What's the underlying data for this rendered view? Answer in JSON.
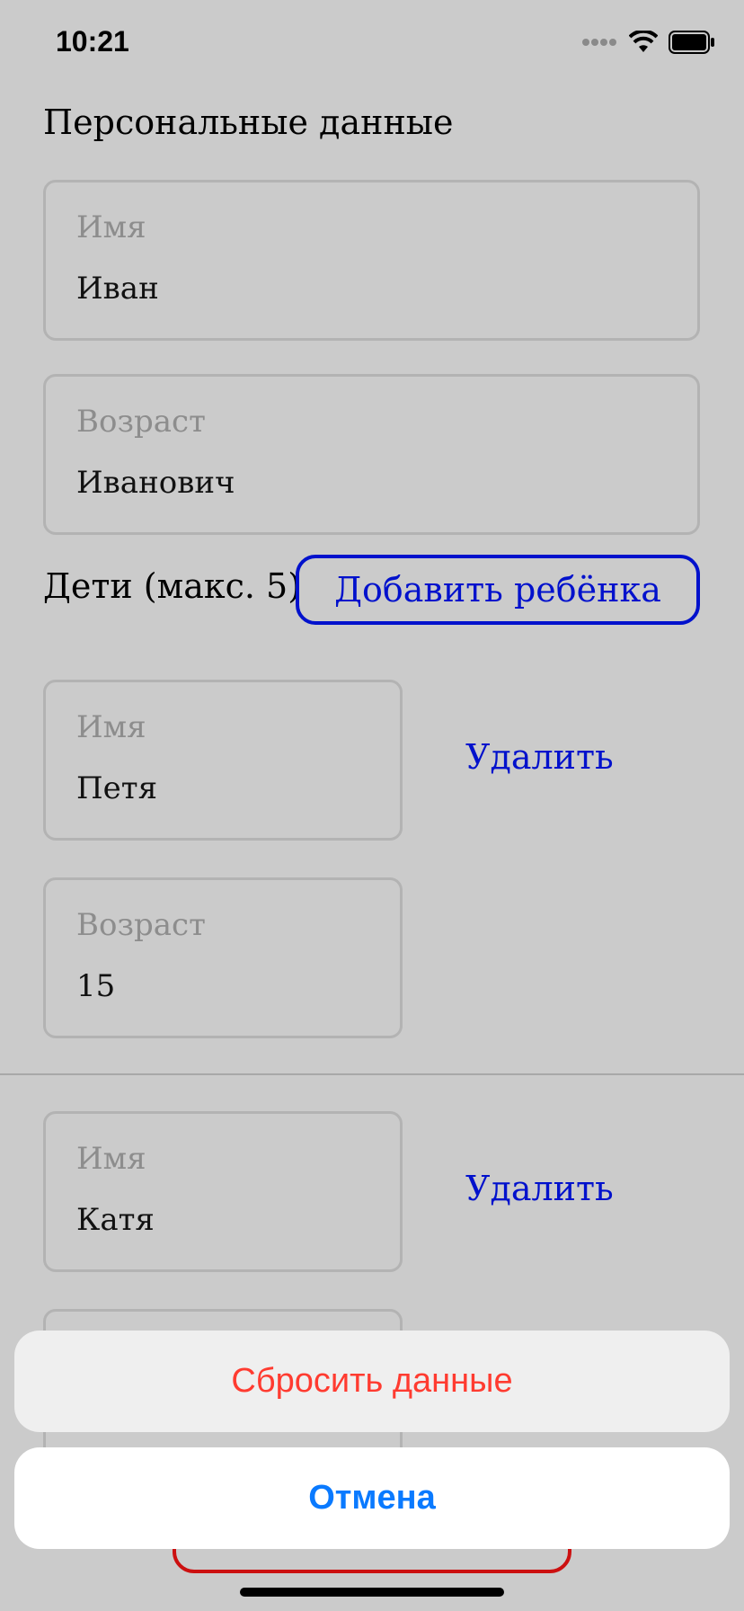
{
  "status_bar": {
    "time": "10:21",
    "icons": [
      "signal-dots-icon",
      "wifi-icon",
      "battery-icon"
    ]
  },
  "personal": {
    "title": "Персональные данные",
    "name_field": {
      "label": "Имя",
      "value": "Иван"
    },
    "age_field": {
      "label": "Возраст",
      "value": "Иванович"
    }
  },
  "children": {
    "label": "Дети (макс. 5)",
    "add_button": "Добавить ребёнка",
    "items": [
      {
        "name_field": {
          "label": "Имя",
          "value": "Петя"
        },
        "age_field": {
          "label": "Возраст",
          "value": "15"
        },
        "delete_label": "Удалить"
      },
      {
        "name_field": {
          "label": "Имя",
          "value": "Катя"
        },
        "delete_label": "Удалить"
      }
    ]
  },
  "action_sheet": {
    "reset_label": "Сбросить данные",
    "cancel_label": "Отмена"
  },
  "colors": {
    "background": "#cbcbcb",
    "accent_blue": "#0011cc",
    "destructive_red": "#ff3b30",
    "system_blue": "#0a7aff"
  }
}
